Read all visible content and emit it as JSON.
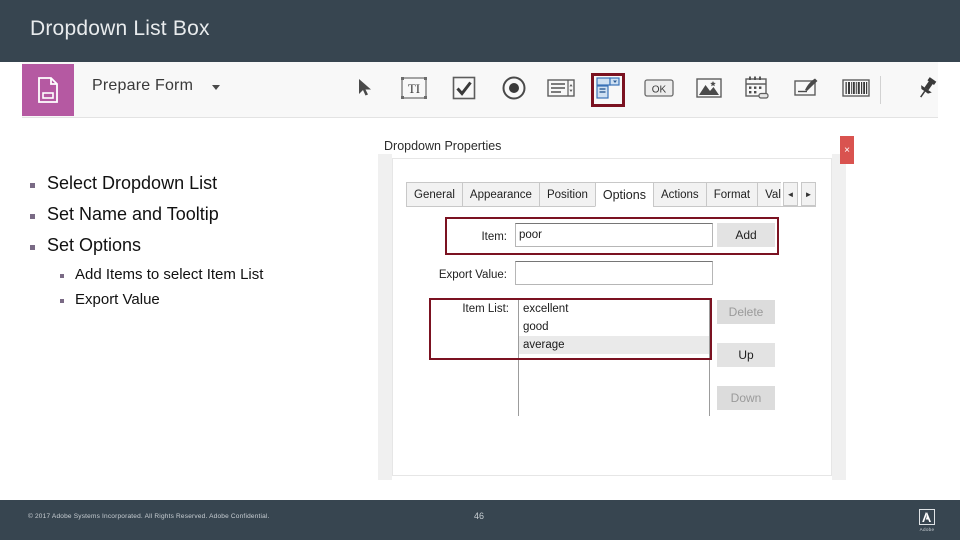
{
  "slide": {
    "title": "Dropdown List Box"
  },
  "toolbar": {
    "prepare_form_label": "Prepare Form",
    "prepare_form_icon": "form-document-icon",
    "caret_icon": "chevron-down-icon",
    "accent_purple": "#b559a2",
    "selection_highlight": "#7b1221",
    "tools": [
      {
        "name": "select-tool",
        "icon": "cursor-arrow-icon",
        "selected": false
      },
      {
        "name": "text-field-tool",
        "icon": "text-field-icon",
        "selected": false
      },
      {
        "name": "checkbox-tool",
        "icon": "checkbox-icon",
        "selected": false
      },
      {
        "name": "radio-button-tool",
        "icon": "radio-button-icon",
        "selected": false
      },
      {
        "name": "list-box-tool",
        "icon": "list-box-icon",
        "selected": false
      },
      {
        "name": "dropdown-tool",
        "icon": "dropdown-icon",
        "selected": true
      },
      {
        "name": "button-tool",
        "icon": "ok-button-icon",
        "selected": false
      },
      {
        "name": "image-field-tool",
        "icon": "image-icon",
        "selected": false
      },
      {
        "name": "date-field-tool",
        "icon": "calendar-icon",
        "selected": false
      },
      {
        "name": "signature-tool",
        "icon": "signature-icon",
        "selected": false
      },
      {
        "name": "barcode-tool",
        "icon": "barcode-icon",
        "selected": false
      },
      {
        "name": "pin-toolbar",
        "icon": "pushpin-icon",
        "selected": false
      }
    ]
  },
  "bullets": [
    {
      "level": 1,
      "text": "Select Dropdown List"
    },
    {
      "level": 1,
      "text": "Set Name and Tooltip"
    },
    {
      "level": 1,
      "text": "Set Options"
    },
    {
      "level": 2,
      "text": "Add Items to select Item List"
    },
    {
      "level": 2,
      "text": "Export Value"
    }
  ],
  "dialog": {
    "title": "Dropdown Properties",
    "close_label": "×",
    "tabs": [
      {
        "label": "General",
        "active": false
      },
      {
        "label": "Appearance",
        "active": false
      },
      {
        "label": "Position",
        "active": false
      },
      {
        "label": "Options",
        "active": true
      },
      {
        "label": "Actions",
        "active": false
      },
      {
        "label": "Format",
        "active": false
      },
      {
        "label": "Vali",
        "active": false
      }
    ],
    "tab_prev_icon": "◄",
    "tab_next_icon": "►",
    "options": {
      "item_label": "Item:",
      "item_value": "poor",
      "item_placeholder": "",
      "add_button": "Add",
      "export_value_label": "Export Value:",
      "export_value": "",
      "export_value_placeholder": "",
      "item_list_label": "Item List:",
      "item_list": [
        {
          "text": "excellent",
          "selected": false
        },
        {
          "text": "good",
          "selected": false
        },
        {
          "text": "average",
          "selected": true
        }
      ],
      "delete_button": "Delete",
      "delete_disabled": true,
      "up_button": "Up",
      "up_disabled": false,
      "down_button": "Down",
      "down_disabled": true
    }
  },
  "footer": {
    "copyright": "© 2017 Adobe Systems Incorporated. All Rights Reserved. Adobe Confidential.",
    "page_number": "46",
    "logo_word": "Adobe",
    "logo_icon": "adobe-a-icon"
  }
}
